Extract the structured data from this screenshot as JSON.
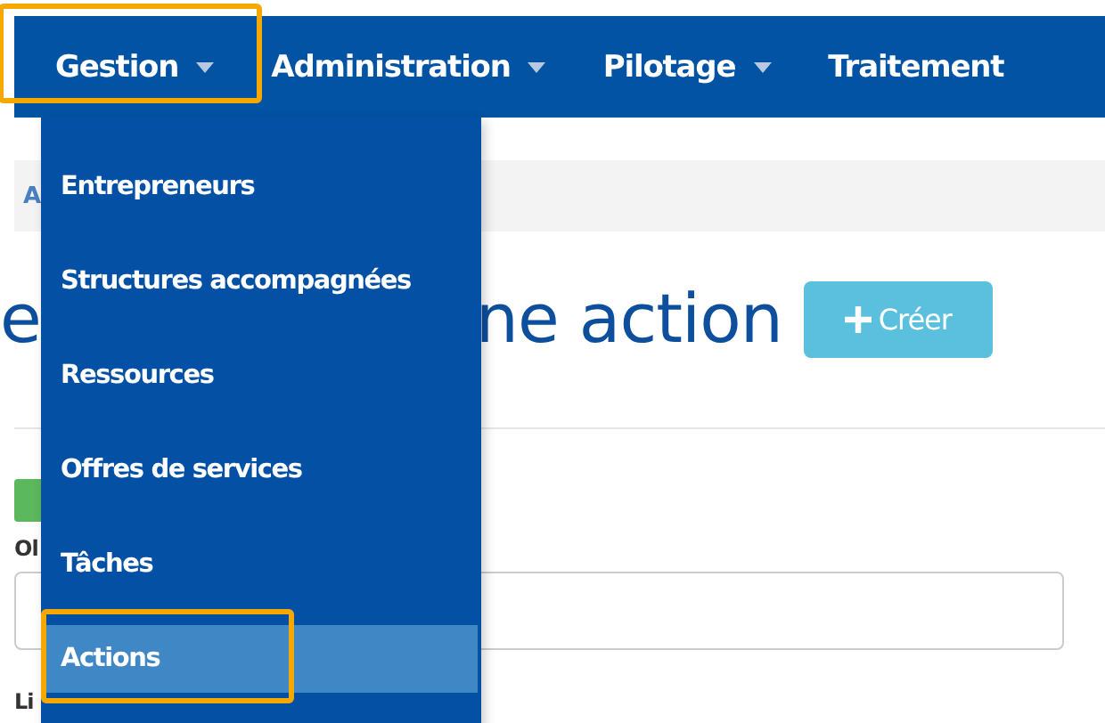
{
  "nav": {
    "items": [
      {
        "label": "Gestion",
        "caret": true,
        "highlighted": true
      },
      {
        "label": "Administration",
        "caret": true,
        "highlighted": false
      },
      {
        "label": "Pilotage",
        "caret": true,
        "highlighted": false
      },
      {
        "label": "Traitement",
        "caret": false,
        "highlighted": false
      }
    ]
  },
  "dropdown": {
    "items": [
      {
        "label": "Entrepreneurs",
        "selected": false,
        "highlighted": false
      },
      {
        "label": "Structures accompagnées",
        "selected": false,
        "highlighted": false
      },
      {
        "label": "Ressources",
        "selected": false,
        "highlighted": false
      },
      {
        "label": "Offres de services",
        "selected": false,
        "highlighted": false
      },
      {
        "label": "Tâches",
        "selected": false,
        "highlighted": false
      },
      {
        "label": "Actions",
        "selected": true,
        "highlighted": true
      }
    ]
  },
  "breadcrumb": "A",
  "title": {
    "parts": [
      "e",
      "ne action"
    ]
  },
  "create_button": {
    "label": "Créer"
  },
  "form": {
    "label_1": "Ol",
    "label_2": "Li"
  }
}
